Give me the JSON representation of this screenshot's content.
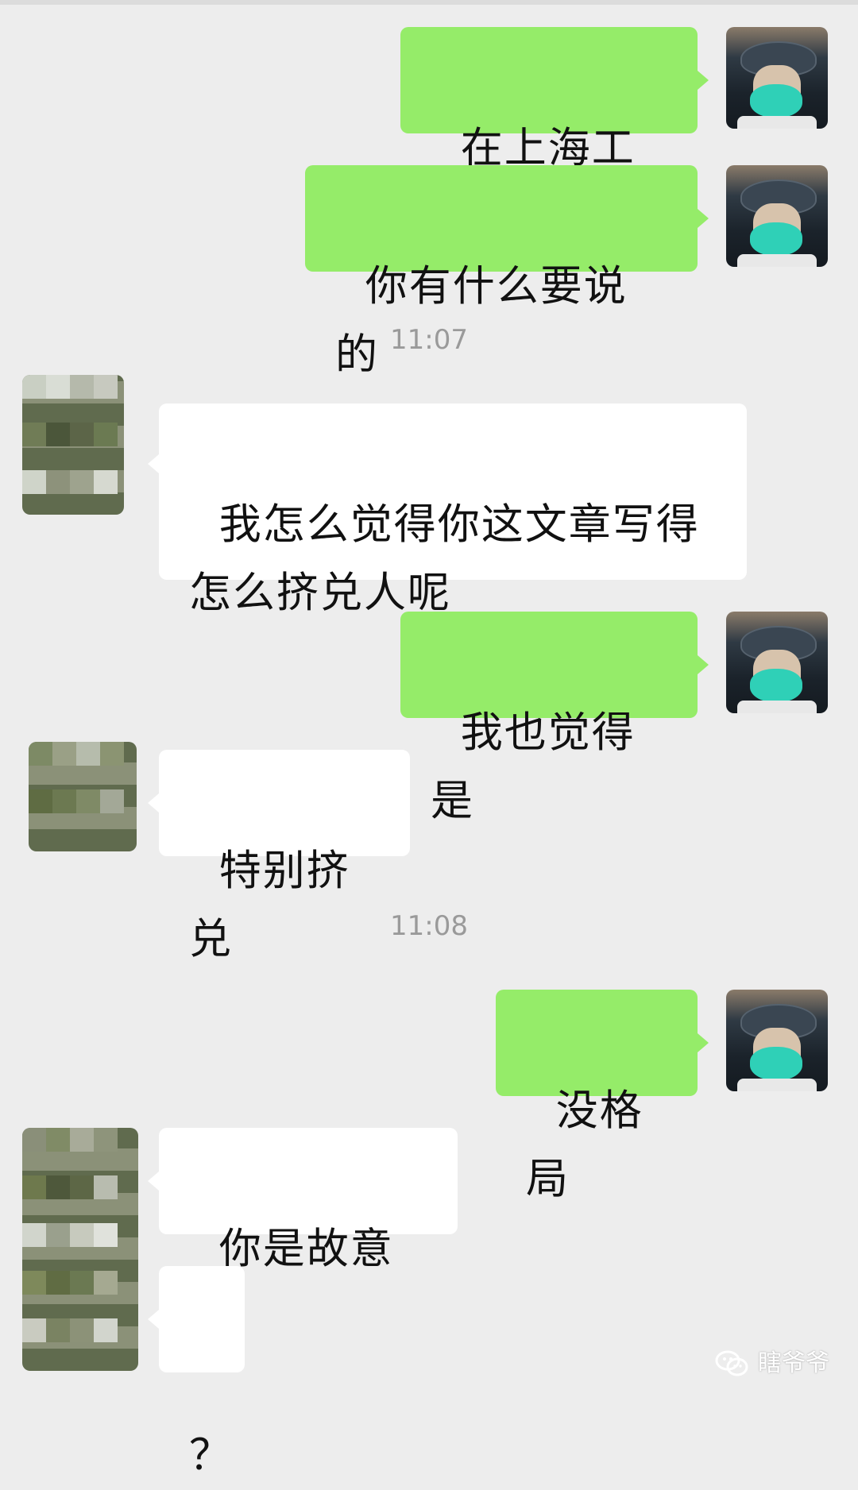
{
  "chat": {
    "messages": [
      {
        "from": "me",
        "text": "在上海工作"
      },
      {
        "from": "me",
        "text": "你有什么要说的"
      },
      {
        "type": "time",
        "text": "11:07"
      },
      {
        "from": "other",
        "text": "我怎么觉得你这文章写得\n怎么挤兑人呢"
      },
      {
        "from": "me",
        "text": "我也觉得是"
      },
      {
        "from": "other",
        "text": "特别挤兑"
      },
      {
        "type": "time",
        "text": "11:08"
      },
      {
        "from": "me",
        "text": "没格局"
      },
      {
        "from": "other",
        "text": "你是故意的"
      },
      {
        "from": "other",
        "text": "？"
      }
    ]
  },
  "watermark": {
    "text": "瞎爷爷",
    "icon": "wechat-icon"
  },
  "colors": {
    "background": "#EDEDED",
    "sent_bubble": "#95EC69",
    "received_bubble": "#FFFFFF",
    "timestamp_text": "#9A9A9A"
  }
}
